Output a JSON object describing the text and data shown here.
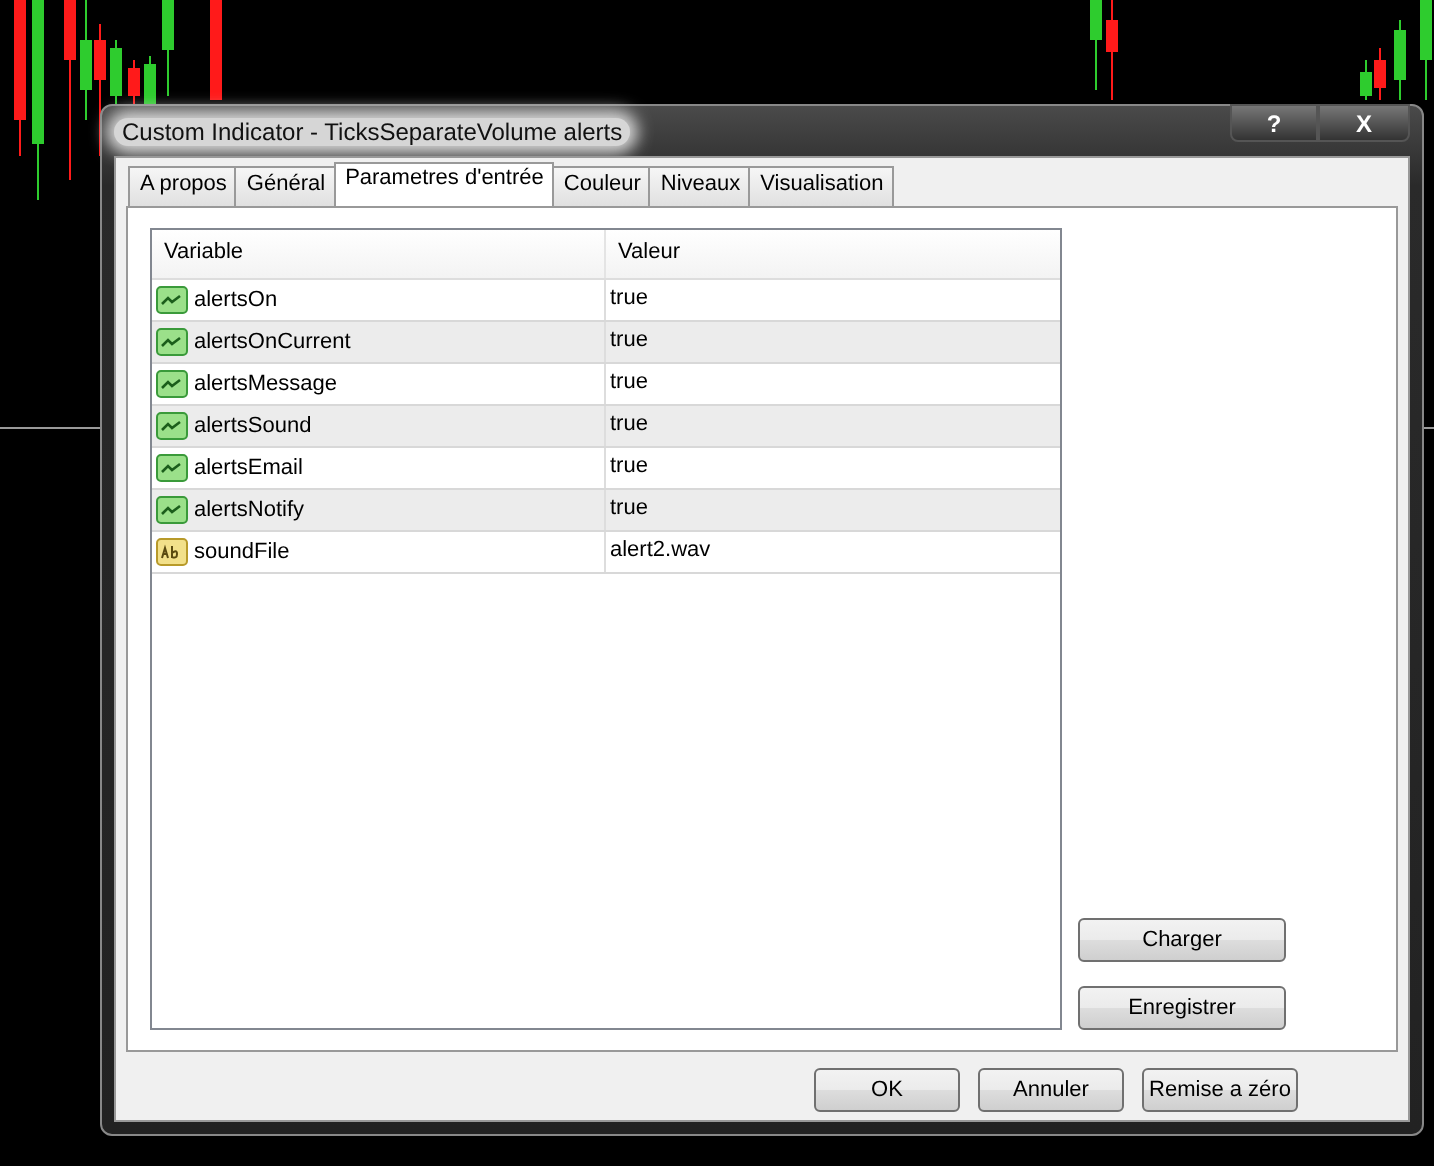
{
  "window": {
    "title": "Custom Indicator - TicksSeparateVolume alerts",
    "help_button": "?",
    "close_button": "X"
  },
  "tabs": [
    {
      "label": "A propos",
      "selected": false
    },
    {
      "label": "Général",
      "selected": false
    },
    {
      "label": "Parametres d'entrée",
      "selected": true
    },
    {
      "label": "Couleur",
      "selected": false
    },
    {
      "label": "Niveaux",
      "selected": false
    },
    {
      "label": "Visualisation",
      "selected": false
    }
  ],
  "table": {
    "columns": [
      "Variable",
      "Valeur"
    ],
    "rows": [
      {
        "kind": "bool",
        "variable": "alertsOn",
        "value": "true"
      },
      {
        "kind": "bool",
        "variable": "alertsOnCurrent",
        "value": "true"
      },
      {
        "kind": "bool",
        "variable": "alertsMessage",
        "value": "true"
      },
      {
        "kind": "bool",
        "variable": "alertsSound",
        "value": "true"
      },
      {
        "kind": "bool",
        "variable": "alertsEmail",
        "value": "true"
      },
      {
        "kind": "bool",
        "variable": "alertsNotify",
        "value": "true"
      },
      {
        "kind": "string",
        "variable": "soundFile",
        "value": "alert2.wav"
      }
    ]
  },
  "side_buttons": [
    "Charger",
    "Enregistrer"
  ],
  "buttons": [
    "OK",
    "Annuler",
    "Remise a zéro"
  ]
}
